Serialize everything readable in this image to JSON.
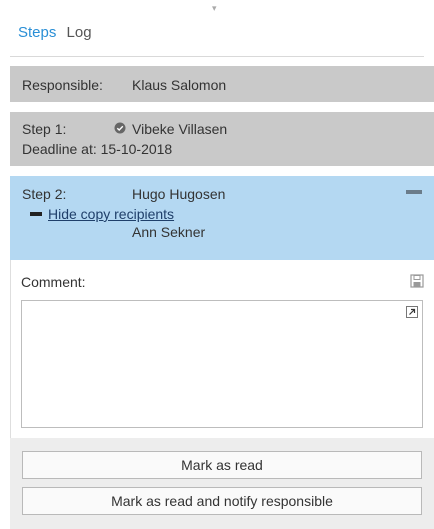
{
  "tabs": {
    "steps": "Steps",
    "log": "Log"
  },
  "responsible": {
    "label": "Responsible:",
    "name": "Klaus Salomon"
  },
  "step1": {
    "label": "Step 1:",
    "name": "Vibeke Villasen",
    "status_icon": "check-circle-icon",
    "deadline": "Deadline at: 15-10-2018"
  },
  "step2": {
    "label": "Step 2:",
    "name": "Hugo Hugosen",
    "hide_copy_recipients": "Hide copy recipients",
    "copy_recipients": [
      "Ann Sekner"
    ]
  },
  "comment": {
    "label": "Comment:",
    "value": ""
  },
  "actions": {
    "mark_read": "Mark as read",
    "mark_read_notify": "Mark as read and notify responsible"
  },
  "colors": {
    "accent": "#2a8fd6",
    "header_gray": "#c9c9c9",
    "active_step": "#b4d8f2"
  }
}
